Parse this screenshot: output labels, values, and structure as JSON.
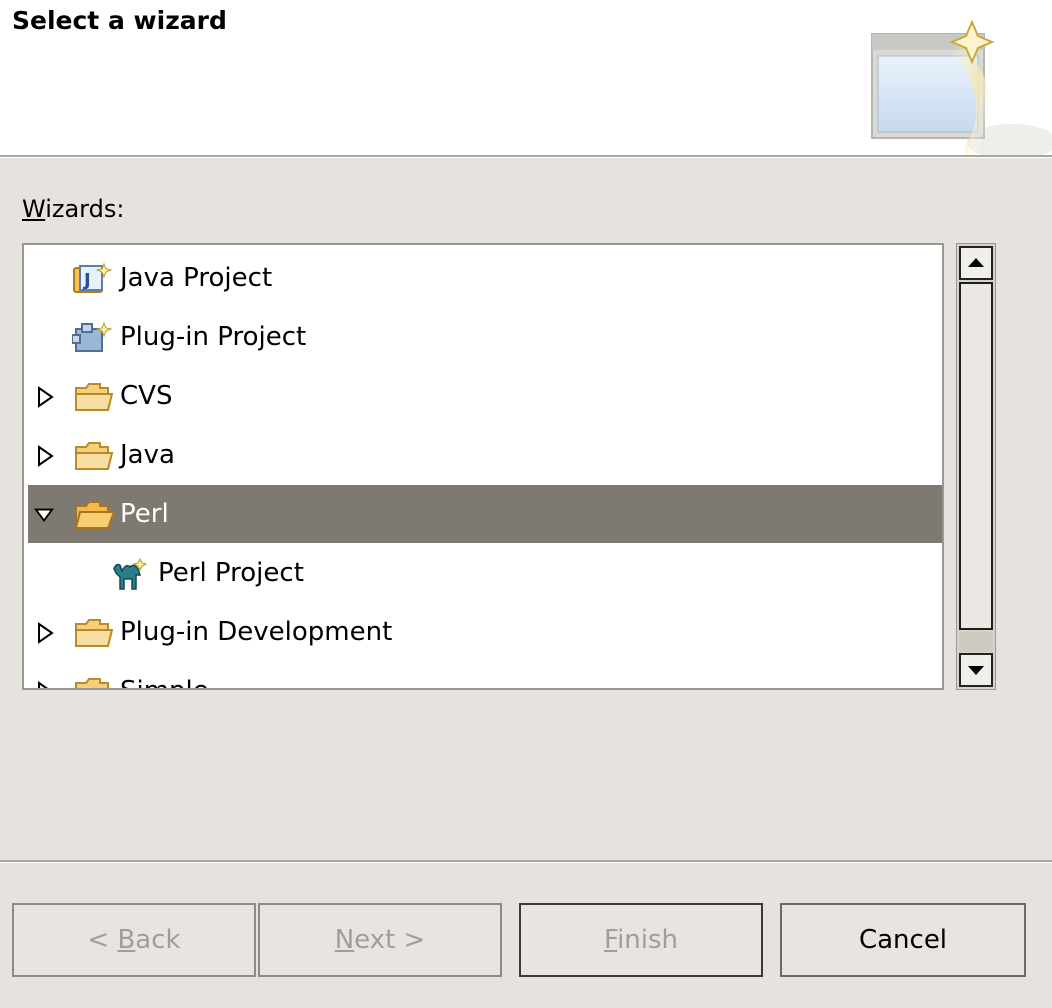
{
  "header": {
    "title": "Select a wizard",
    "icon": "new-wizard-banner-icon"
  },
  "wizards_label": {
    "accel": "W",
    "rest": "izards:"
  },
  "tree": {
    "items": [
      {
        "label": "Java Project",
        "icon": "java-project-icon",
        "expandable": false,
        "expanded": false,
        "depth": 0
      },
      {
        "label": "Plug-in Project",
        "icon": "plugin-project-icon",
        "expandable": false,
        "expanded": false,
        "depth": 0
      },
      {
        "label": "CVS",
        "icon": "folder-icon",
        "expandable": true,
        "expanded": false,
        "depth": 0
      },
      {
        "label": "Java",
        "icon": "folder-icon",
        "expandable": true,
        "expanded": false,
        "depth": 0
      },
      {
        "label": "Perl",
        "icon": "folder-open-icon",
        "expandable": true,
        "expanded": true,
        "depth": 0,
        "selected": true
      },
      {
        "label": "Perl Project",
        "icon": "perl-camel-icon",
        "expandable": false,
        "expanded": false,
        "depth": 1
      },
      {
        "label": "Plug-in Development",
        "icon": "folder-icon",
        "expandable": true,
        "expanded": false,
        "depth": 0
      },
      {
        "label": "Simple",
        "icon": "folder-icon",
        "expandable": true,
        "expanded": false,
        "depth": 0
      }
    ]
  },
  "buttons": {
    "back": {
      "prefix": "< ",
      "accel": "B",
      "rest": "ack",
      "enabled": false
    },
    "next": {
      "accel": "N",
      "rest": "ext >",
      "enabled": false
    },
    "finish": {
      "accel": "F",
      "rest": "inish",
      "enabled": false
    },
    "cancel": {
      "label": "Cancel",
      "enabled": true
    }
  },
  "colors": {
    "selection": "#7e7a71",
    "dialog_bg": "#e6e3de",
    "folder": "#f3b94a"
  }
}
